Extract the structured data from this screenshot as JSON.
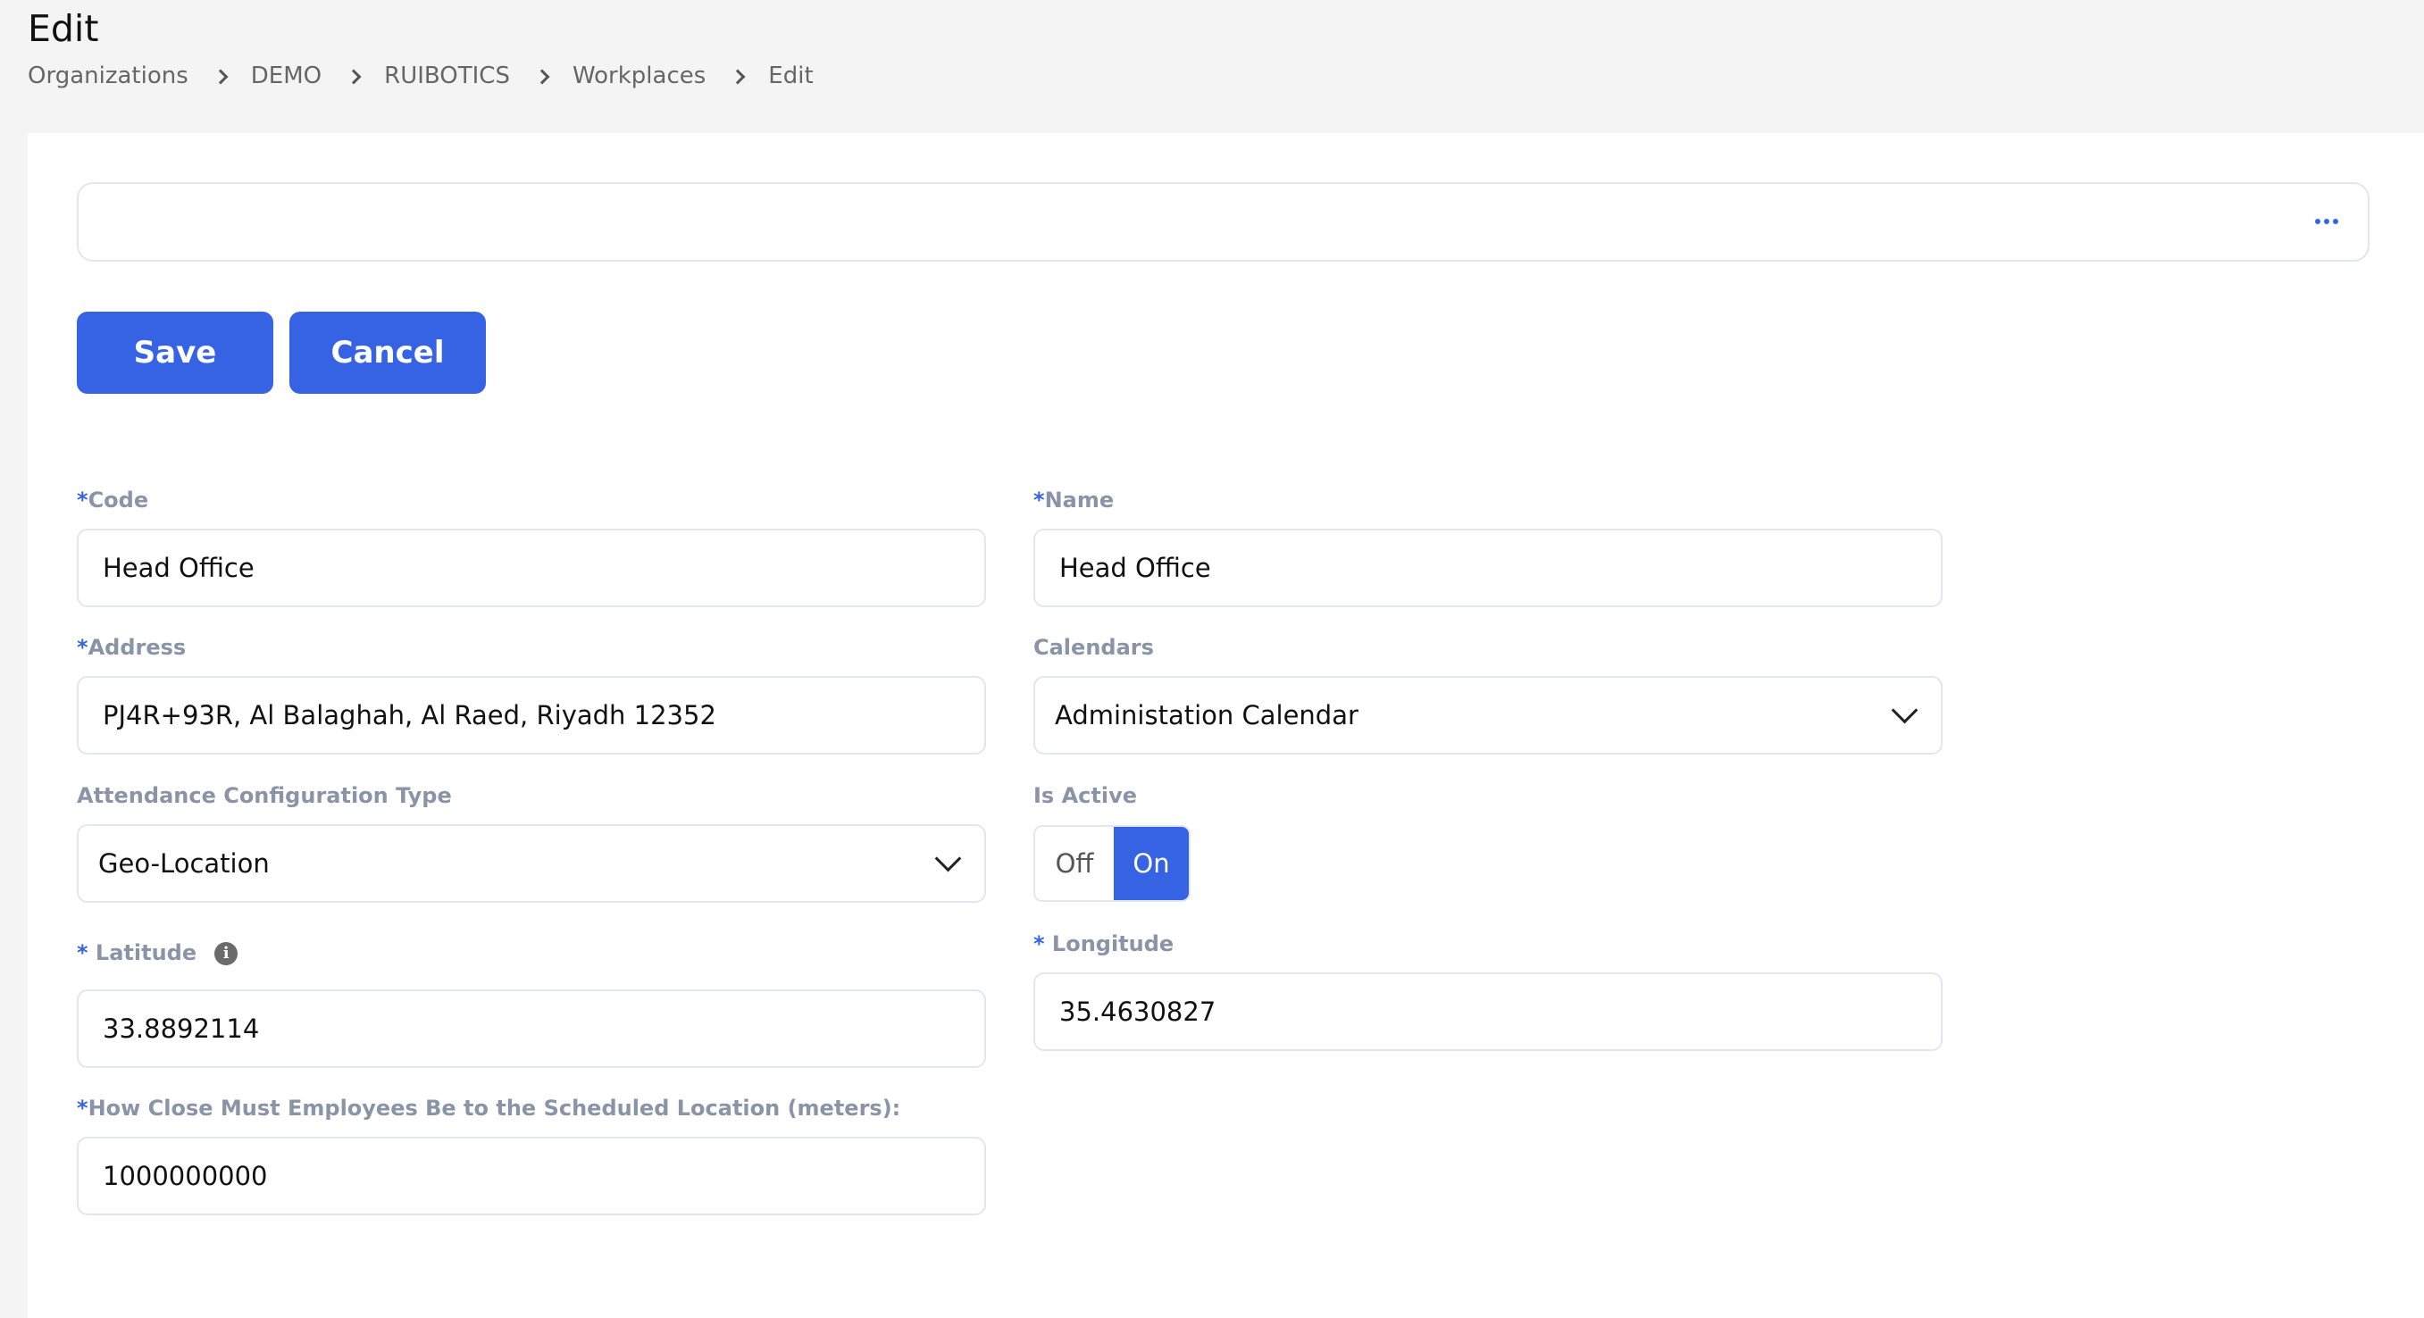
{
  "page": {
    "title": "Edit"
  },
  "breadcrumb": [
    "Organizations",
    "DEMO",
    "RUIBOTICS",
    "Workplaces",
    "Edit"
  ],
  "toolbar": {
    "save_label": "Save",
    "cancel_label": "Cancel",
    "more_icon": "more-horizontal-icon"
  },
  "form": {
    "code": {
      "label": "Code",
      "required_mark": "*",
      "value": "Head Office"
    },
    "name": {
      "label": "Name",
      "required_mark": "*",
      "value": "Head Office"
    },
    "address": {
      "label": "Address",
      "required_mark": "*",
      "value": "PJ4R+93R, Al Balaghah, Al Raed, Riyadh 12352"
    },
    "calendars": {
      "label": "Calendars",
      "value": "Administation Calendar"
    },
    "attendance_type": {
      "label": "Attendance Configuration Type",
      "value": "Geo-Location"
    },
    "is_active": {
      "label": "Is Active",
      "off_label": "Off",
      "on_label": "On",
      "selected": "On"
    },
    "latitude": {
      "label": "Latitude",
      "required_mark": "* ",
      "value": "33.8892114",
      "info_icon": "info-icon"
    },
    "longitude": {
      "label": "Longitude",
      "required_mark": "* ",
      "value": "35.4630827"
    },
    "radius": {
      "label": "How Close Must Employees Be to the Scheduled Location (meters):",
      "required_mark": "*",
      "value": "1000000000"
    }
  },
  "colors": {
    "accent": "#3563e3",
    "label": "#8a94a6",
    "background": "#f4f4f4"
  }
}
